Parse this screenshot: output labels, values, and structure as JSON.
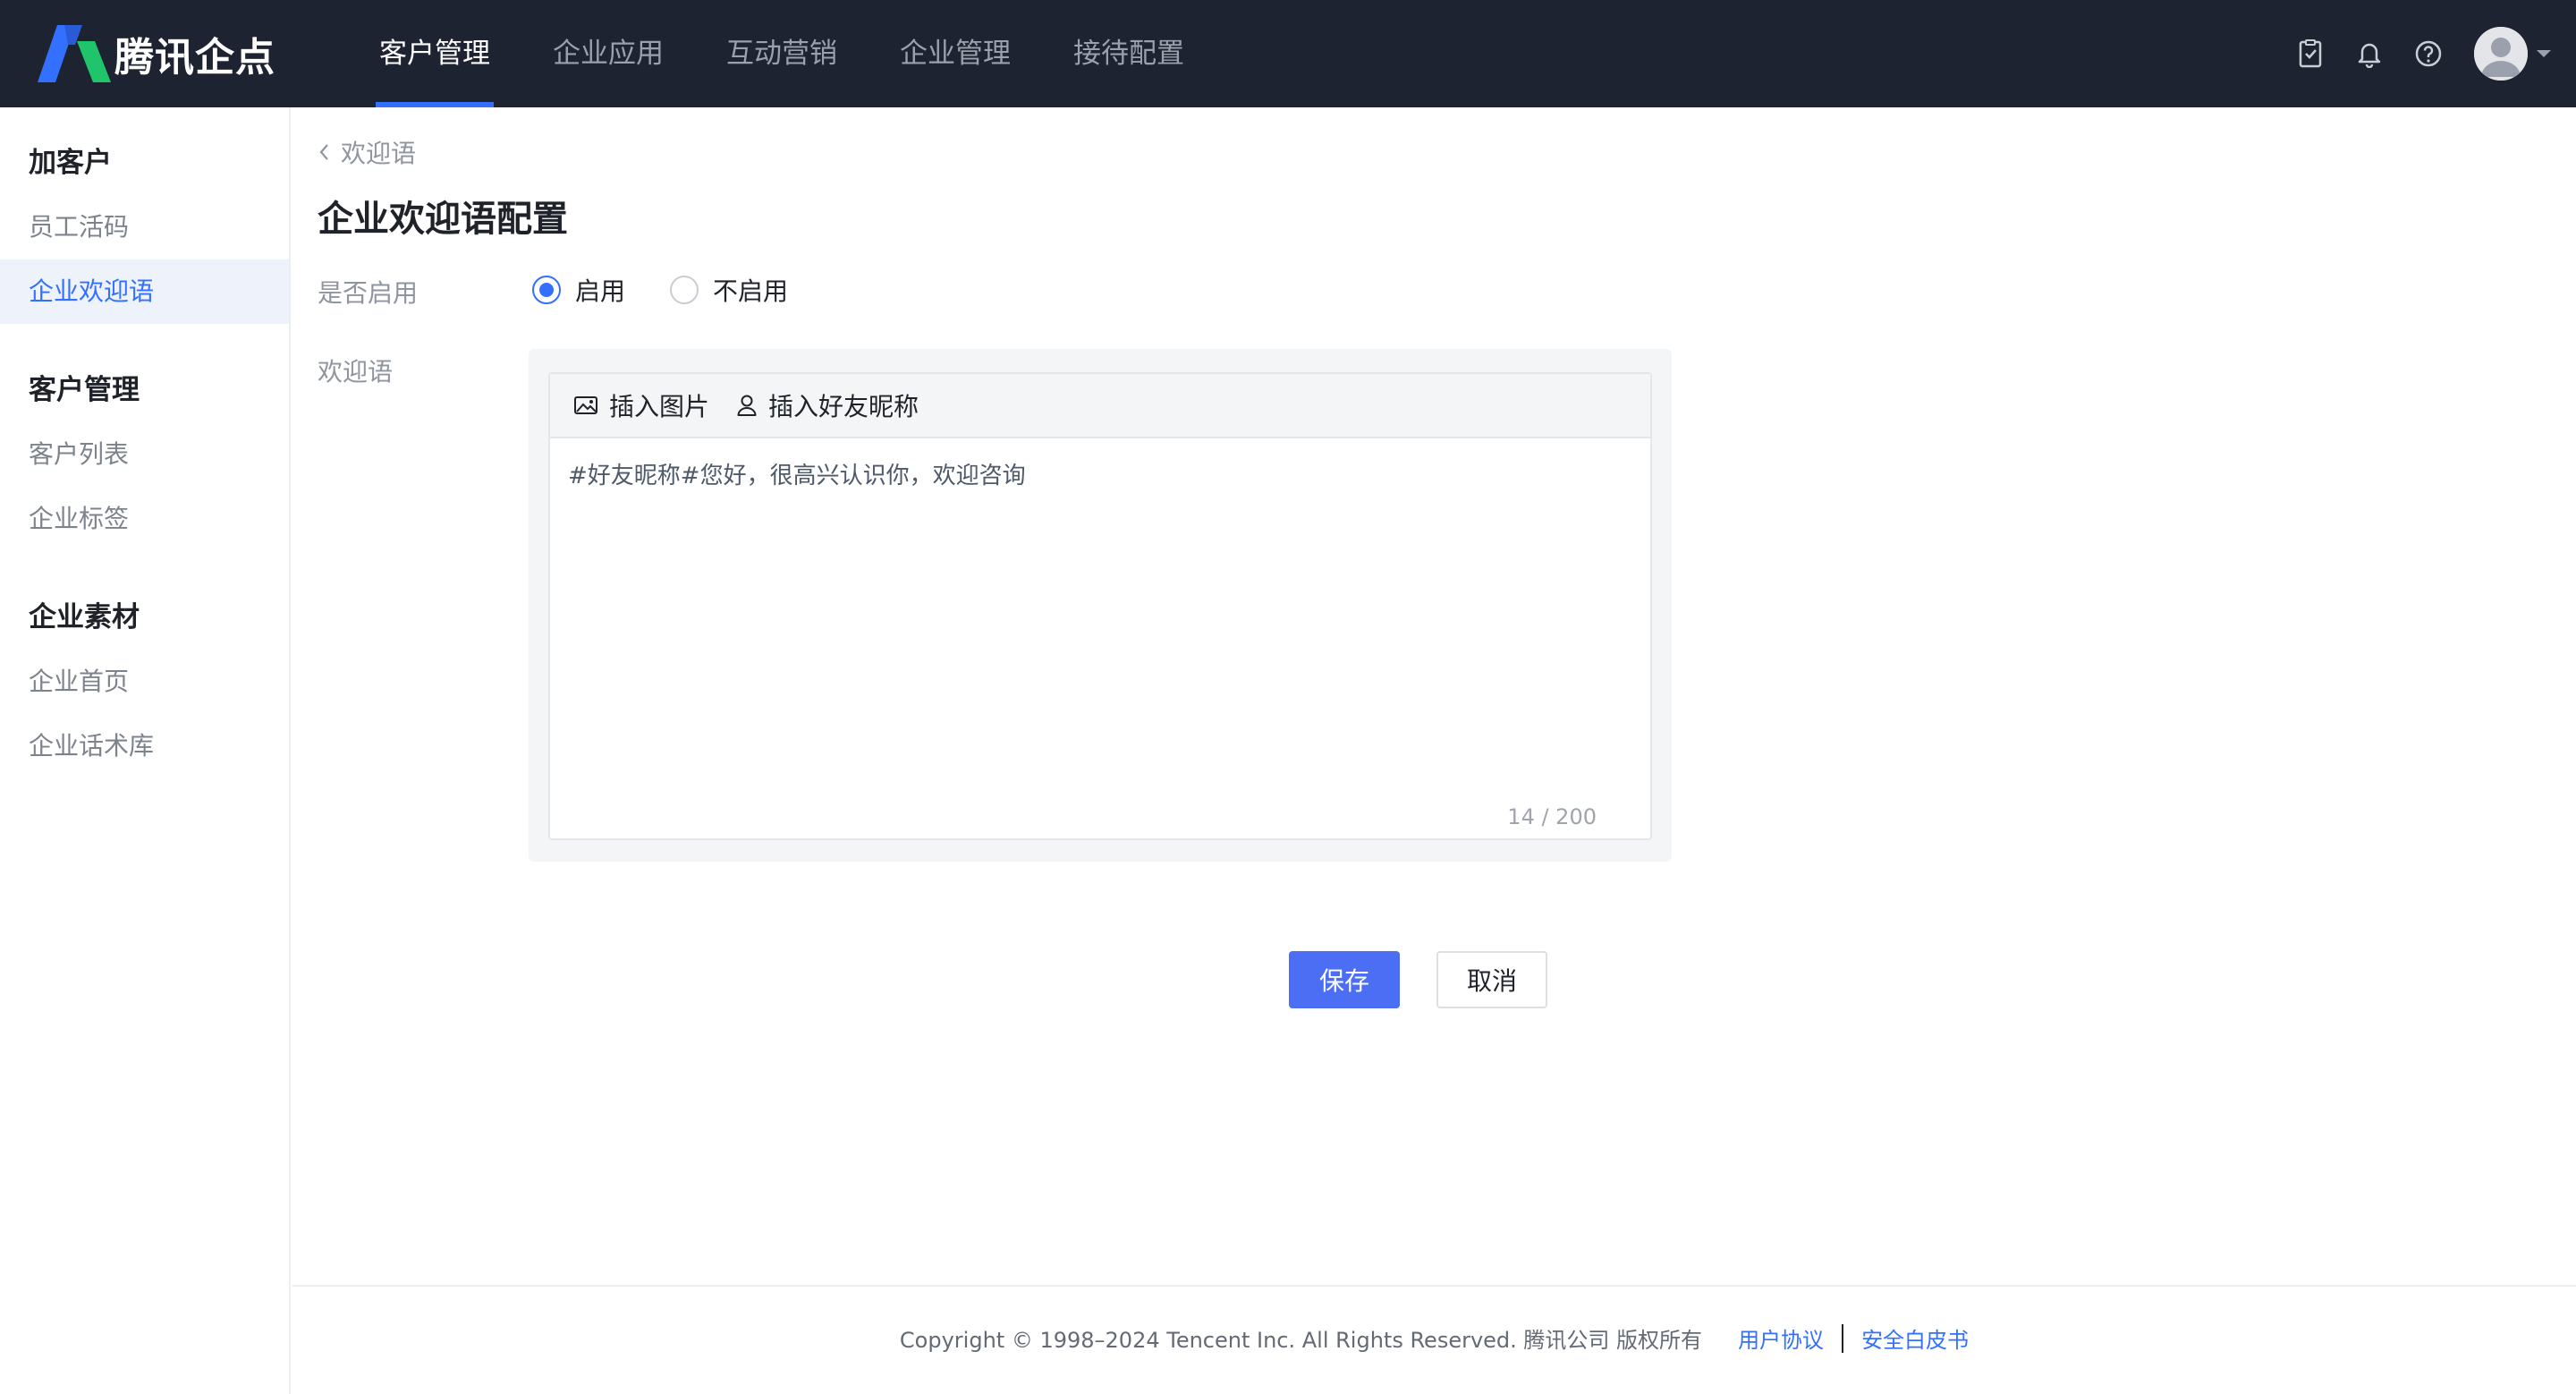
{
  "app": {
    "brand": "腾讯企点",
    "brand_color": "#3370ff",
    "topbar_bg": "#1d2330"
  },
  "nav": {
    "items": [
      {
        "label": "客户管理",
        "active": true
      },
      {
        "label": "企业应用",
        "active": false
      },
      {
        "label": "互动营销",
        "active": false
      },
      {
        "label": "企业管理",
        "active": false
      },
      {
        "label": "接待配置",
        "active": false
      }
    ]
  },
  "top_actions": {
    "icons": [
      "task-check-icon",
      "bell-icon",
      "help-icon",
      "avatar",
      "chevron-down-icon"
    ]
  },
  "sidebar": {
    "groups": [
      {
        "title": "加客户",
        "items": [
          {
            "label": "员工活码",
            "active": false
          },
          {
            "label": "企业欢迎语",
            "active": true
          }
        ]
      },
      {
        "title": "客户管理",
        "items": [
          {
            "label": "客户列表",
            "active": false
          },
          {
            "label": "企业标签",
            "active": false
          }
        ]
      },
      {
        "title": "企业素材",
        "items": [
          {
            "label": "企业首页",
            "active": false
          },
          {
            "label": "企业话术库",
            "active": false
          }
        ]
      }
    ]
  },
  "page": {
    "back_label": "欢迎语",
    "title": "企业欢迎语配置",
    "enable_label": "是否启用",
    "radio_on": "启用",
    "radio_off": "不启用",
    "radio_selected": "启用",
    "welcome_label": "欢迎语",
    "toolbar": {
      "insert_image": "插入图片",
      "insert_nickname": "插入好友昵称"
    },
    "welcome_text": "#好友昵称#您好，很高兴认识你，欢迎咨询",
    "counter": "14 / 200",
    "save_label": "保存",
    "cancel_label": "取消"
  },
  "footer": {
    "copyright": "Copyright © 1998–2024 Tencent Inc. All Rights Reserved. 腾讯公司 版权所有",
    "link_agreement": "用户协议",
    "link_whitepaper": "安全白皮书"
  }
}
